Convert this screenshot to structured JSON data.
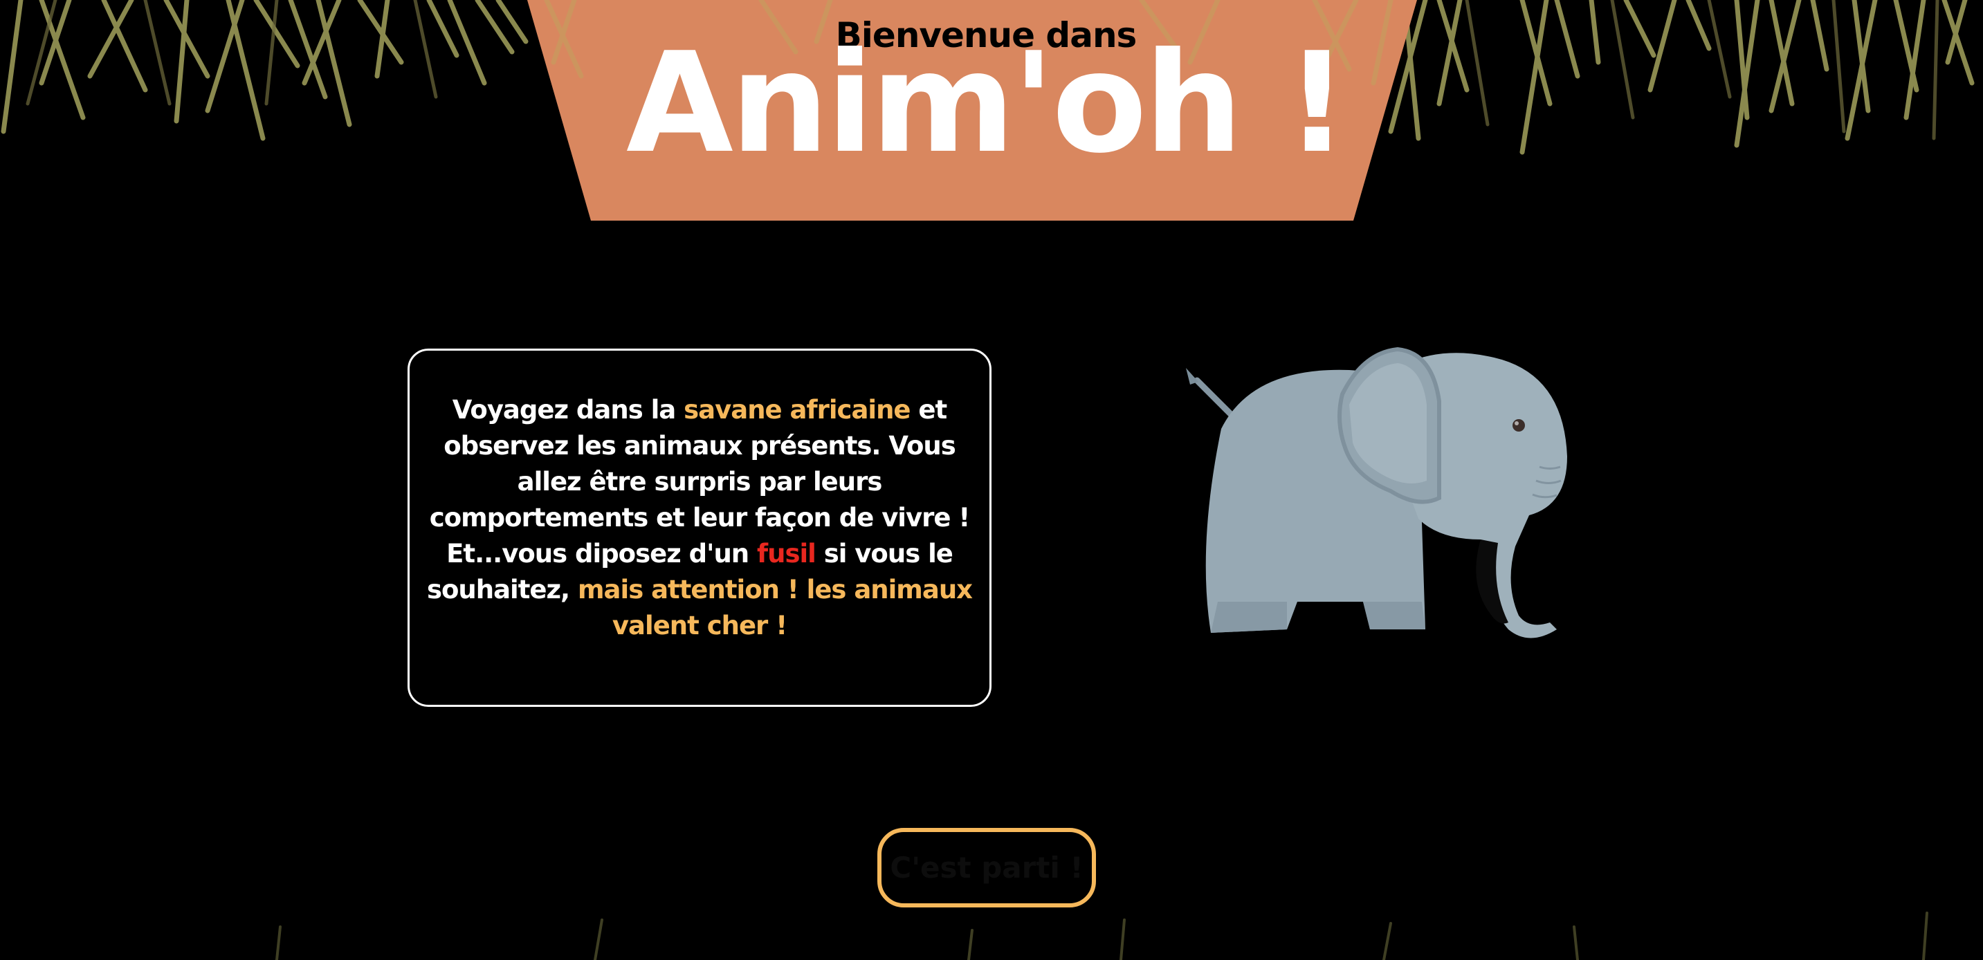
{
  "header": {
    "welcome": "Bienvenue dans",
    "title": "Anim'oh !"
  },
  "intro": {
    "t1": "Voyagez dans la ",
    "h1": "savane africaine",
    "t2": " et observez les animaux présents. Vous allez être surpris par leurs comportements et leur façon de vivre ! Et...vous diposez d'un ",
    "h2": "fusil",
    "t3": " si vous le souhaitez, ",
    "h3": "mais attention ! les animaux valent cher !"
  },
  "cta": {
    "label": "C'est parti !"
  },
  "colors": {
    "banner": "#d9875f",
    "accent_orange": "#f6b85b",
    "accent_red": "#e8271f",
    "elephant": "#97a9b4",
    "grass": "#a0a05a",
    "background": "#000000"
  },
  "icons": {
    "elephant": "elephant-illustration",
    "grass": "savanna-grass-decoration"
  }
}
